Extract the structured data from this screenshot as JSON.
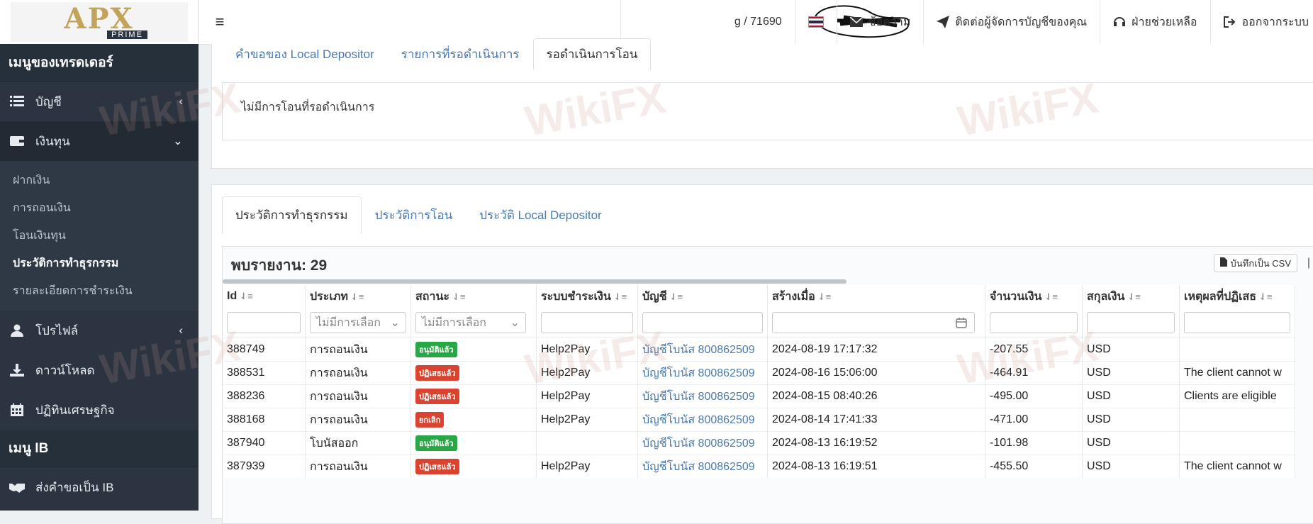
{
  "logo": {
    "brand": "APX",
    "sub": "PRIME"
  },
  "sidebar": {
    "trader_menu": "เมนูของเทรดเดอร์",
    "items": [
      {
        "label": "บัญชี"
      },
      {
        "label": "เงินทุน"
      },
      {
        "label": "โปรไฟล์"
      },
      {
        "label": "ดาวน์โหลด"
      },
      {
        "label": "ปฏิทินเศรษฐกิจ"
      }
    ],
    "sub_items": [
      {
        "label": "ฝากเงิน"
      },
      {
        "label": "การถอนเงิน"
      },
      {
        "label": "โอนเงินทุน"
      },
      {
        "label": "ประวัติการทำธุรกรรม"
      },
      {
        "label": "รายละเอียดการชำระเงิน"
      }
    ],
    "ib_menu": "เมนู IB",
    "ib_item": "ส่งคำขอเป็น IB"
  },
  "topbar": {
    "user": "g / 71690",
    "messages": "ข้อความ",
    "contact": "ติดต่อผู้จัดการบัญชีของคุณ",
    "support": "ฝ่ายช่วยเหลือ",
    "logout": "ออกจากระบบ"
  },
  "panel1": {
    "tabs": [
      "คำขอของ Local Depositor",
      "รายการที่รอดำเนินการ",
      "รอดำเนินการโอน"
    ],
    "empty_text": "ไม่มีการโอนที่รอดำเนินการ"
  },
  "panel2": {
    "tabs": [
      "ประวัติการทำธุรกรรม",
      "ประวัติการโอน",
      "ประวัติ Local Depositor"
    ],
    "found": "พบรายงาน: 29",
    "csv": "บันทึกเป็น CSV",
    "columns": [
      "Id",
      "ประเภท",
      "สถานะ",
      "ระบบชำระเงิน",
      "บัญชี",
      "สร้างเมื่อ",
      "จำนวนเงิน",
      "สกุลเงิน",
      "เหตุผลที่ปฏิเสธ"
    ],
    "filter_placeholder": "ไม่มีการเลือก",
    "rows": [
      {
        "id": "388749",
        "type": "การถอนเงิน",
        "status": "อนุมัติแล้ว",
        "status_kind": "approved",
        "system": "Help2Pay",
        "account": "บัญชีโบนัส 800862509",
        "created": "2024-08-19 17:17:32",
        "amount": "-207.55",
        "currency": "USD",
        "reason": ""
      },
      {
        "id": "388531",
        "type": "การถอนเงิน",
        "status": "ปฏิเสธแล้ว",
        "status_kind": "rejected",
        "system": "Help2Pay",
        "account": "บัญชีโบนัส 800862509",
        "created": "2024-08-16 15:06:00",
        "amount": "-464.91",
        "currency": "USD",
        "reason": "The client cannot w"
      },
      {
        "id": "388236",
        "type": "การถอนเงิน",
        "status": "ปฏิเสธแล้ว",
        "status_kind": "rejected",
        "system": "Help2Pay",
        "account": "บัญชีโบนัส 800862509",
        "created": "2024-08-15 08:40:26",
        "amount": "-495.00",
        "currency": "USD",
        "reason": "Clients are eligible"
      },
      {
        "id": "388168",
        "type": "การถอนเงิน",
        "status": "ยกเลิก",
        "status_kind": "cancelled",
        "system": "Help2Pay",
        "account": "บัญชีโบนัส 800862509",
        "created": "2024-08-14 17:41:33",
        "amount": "-471.00",
        "currency": "USD",
        "reason": ""
      },
      {
        "id": "387940",
        "type": "โบนัสออก",
        "status": "อนุมัติแล้ว",
        "status_kind": "approved",
        "system": "",
        "account": "บัญชีโบนัส 800862509",
        "created": "2024-08-13 16:19:52",
        "amount": "-101.98",
        "currency": "USD",
        "reason": ""
      },
      {
        "id": "387939",
        "type": "การถอนเงิน",
        "status": "ปฏิเสธแล้ว",
        "status_kind": "rejected",
        "system": "Help2Pay",
        "account": "บัญชีโบนัส 800862509",
        "created": "2024-08-13 16:19:51",
        "amount": "-455.50",
        "currency": "USD",
        "reason": "The client cannot w"
      }
    ]
  },
  "watermark": "WikiFX",
  "colors": {
    "sidebar": "#2b3440",
    "link": "#4a7ab0",
    "approved": "#28a745",
    "rejected": "#d9432f"
  }
}
